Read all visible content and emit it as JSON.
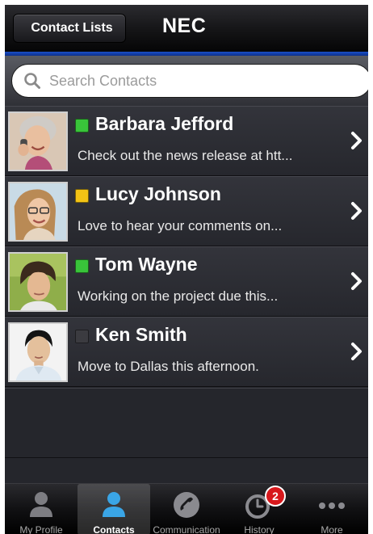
{
  "navbar": {
    "back_label": "Contact Lists",
    "title": "NEC"
  },
  "search": {
    "placeholder": "Search Contacts",
    "icon": "search-icon"
  },
  "contacts": [
    {
      "name": "Barbara Jefford",
      "message": "Check out the news release at htt...",
      "status": "available",
      "status_color": "#39c43a",
      "avatar": "woman-on-phone-photo"
    },
    {
      "name": "Lucy Johnson",
      "message": "Love to hear your comments on...",
      "status": "away",
      "status_color": "#f3c315",
      "avatar": "woman-with-glasses-photo"
    },
    {
      "name": "Tom Wayne",
      "message": "Working on the project due this...",
      "status": "available",
      "status_color": "#39c43a",
      "avatar": "young-man-photo"
    },
    {
      "name": "Ken Smith",
      "message": "Move to Dallas this afternoon.",
      "status": "offline",
      "status_color": "#3b3b40",
      "avatar": "man-in-shirt-photo"
    }
  ],
  "tabbar": {
    "tabs": [
      {
        "label": "My Profile",
        "icon": "person-icon",
        "selected": false
      },
      {
        "label": "Contacts",
        "icon": "person-icon",
        "selected": true
      },
      {
        "label": "Communication",
        "icon": "phone-icon",
        "selected": false
      },
      {
        "label": "History",
        "icon": "clock-icon",
        "selected": false,
        "badge": "2"
      },
      {
        "label": "More",
        "icon": "more-dots-icon",
        "selected": false
      }
    ]
  },
  "colors": {
    "accent_stripe": "#1a4fc6",
    "selected_icon": "#3aa5e6",
    "badge": "#d7181c"
  }
}
